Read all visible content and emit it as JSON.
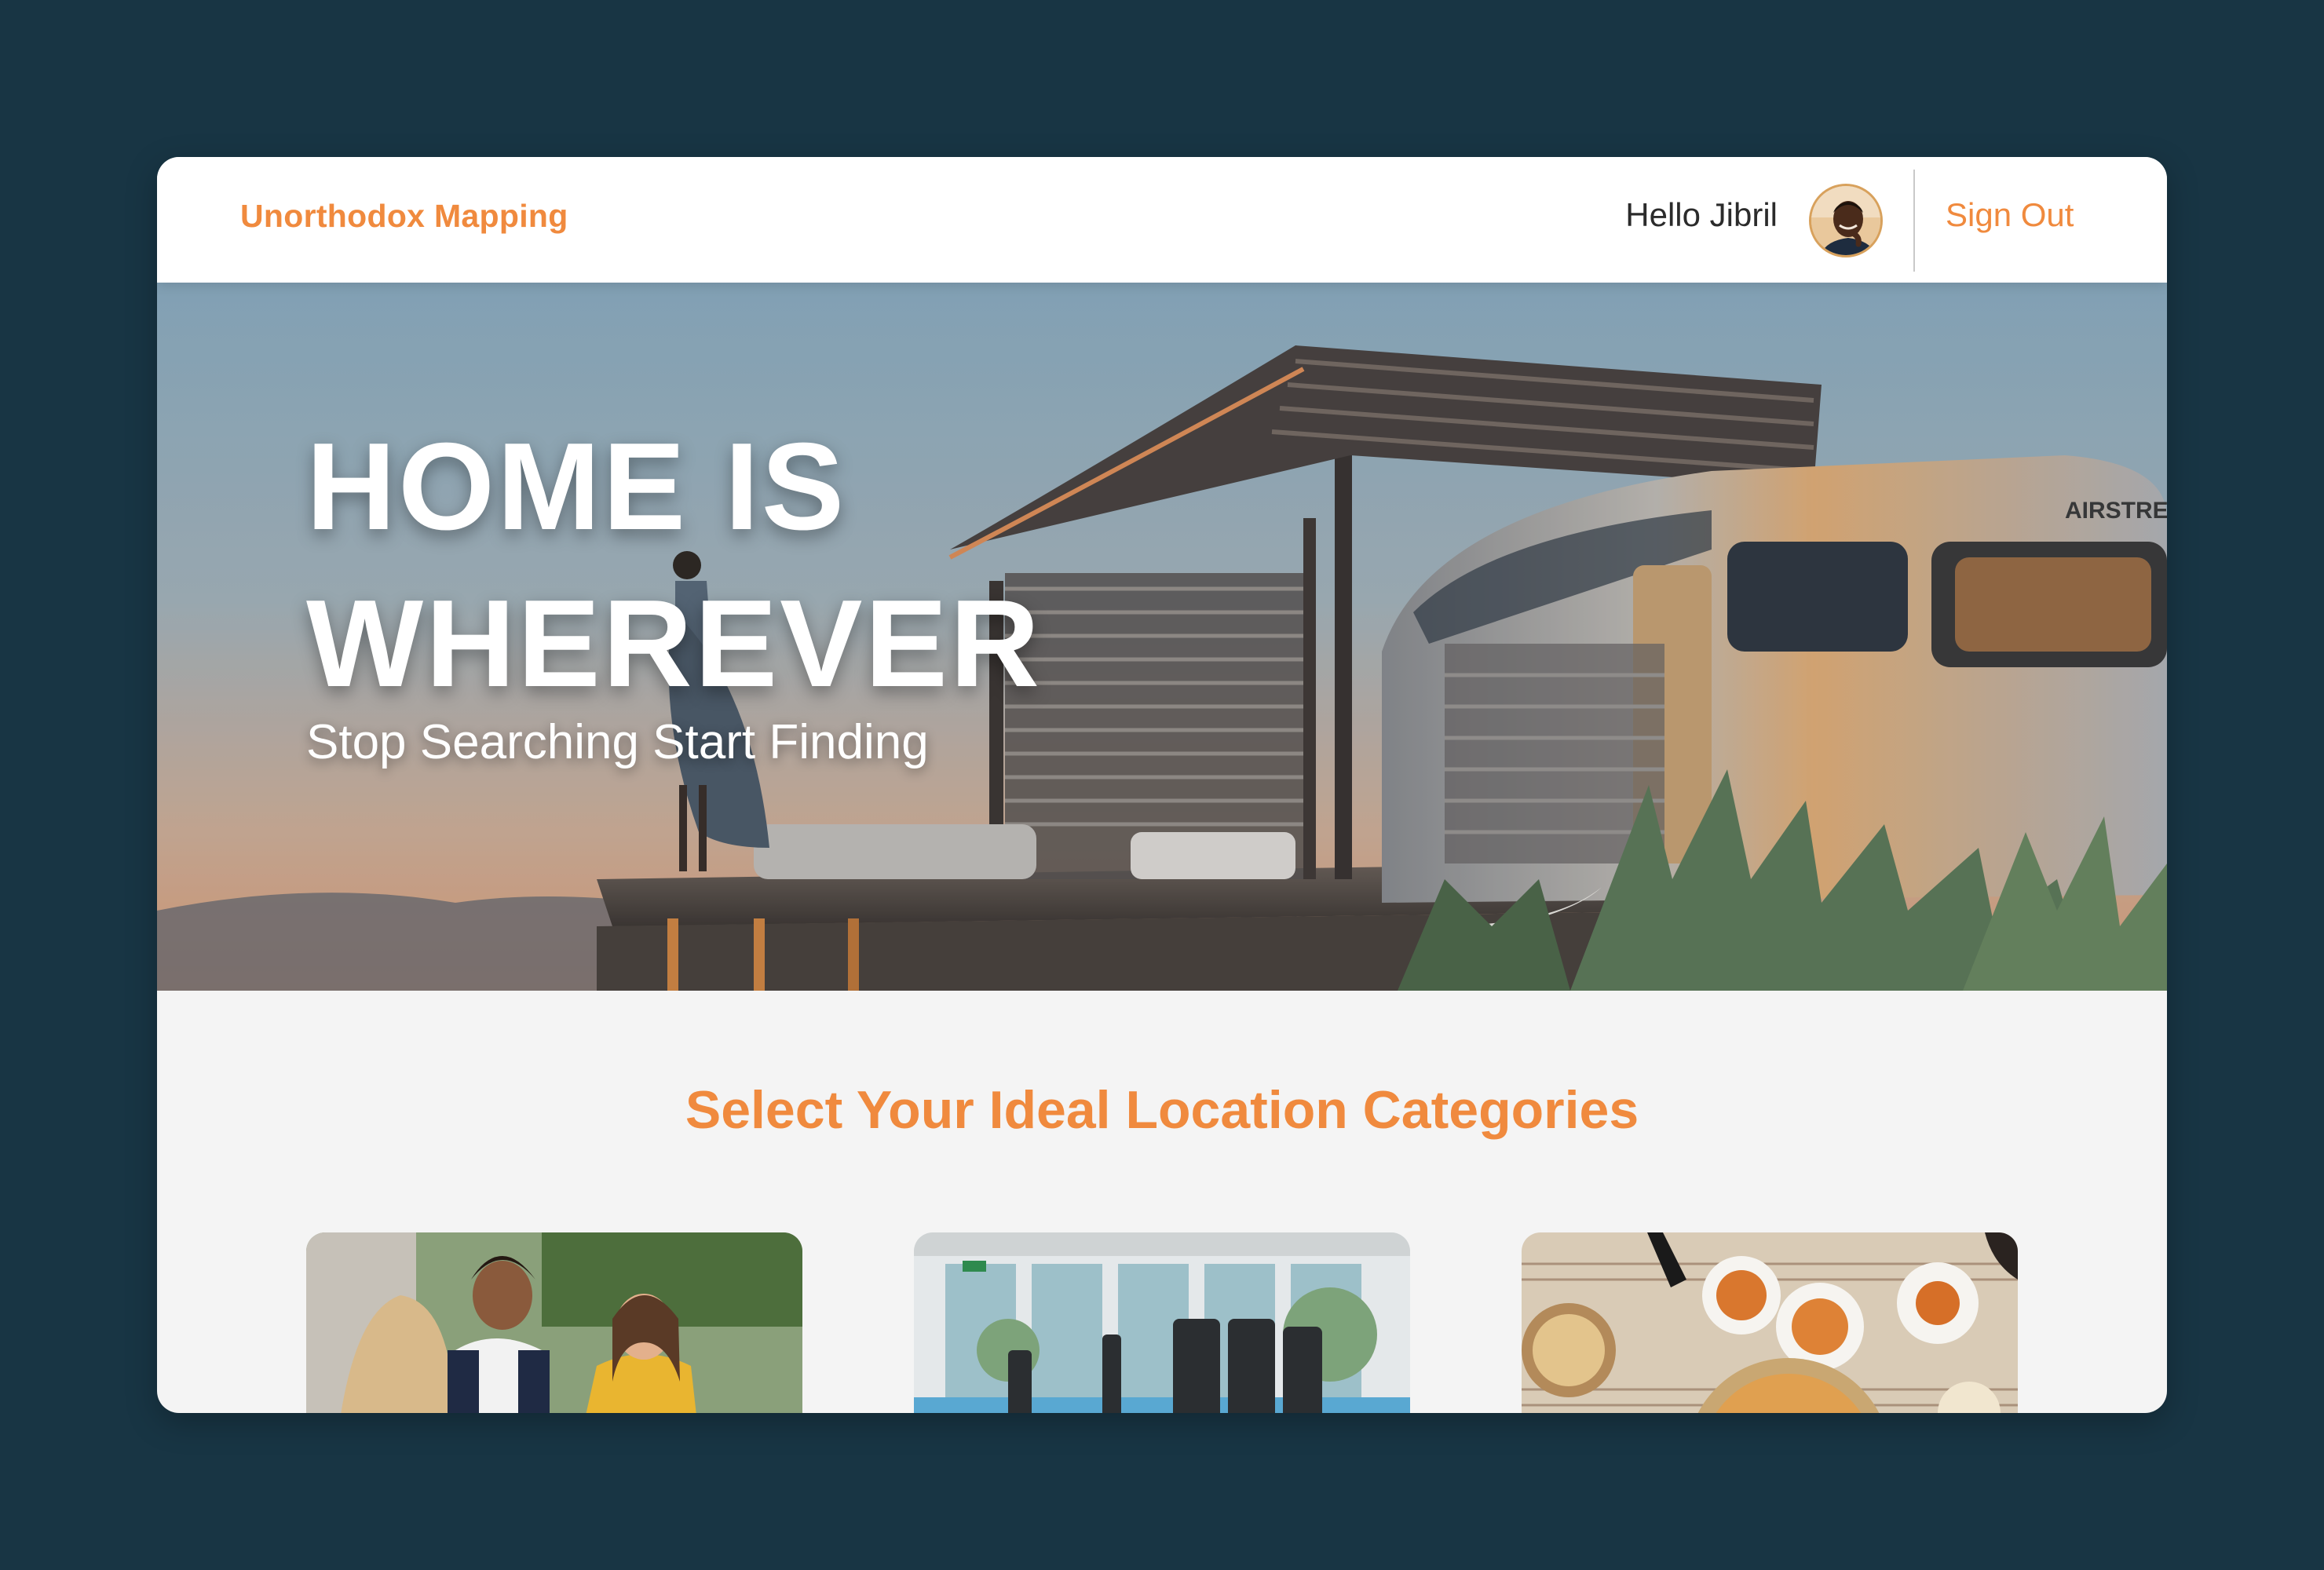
{
  "header": {
    "brand": "Unorthodox Mapping",
    "greeting": "Hello Jibril",
    "avatar_icon": "user-avatar-icon",
    "sign_out": "Sign Out"
  },
  "hero": {
    "title_line1": "HOME IS",
    "title_line2": "WHEREVER",
    "subtitle": "Stop Searching Start Finding",
    "trailer_text": "AIRSTREA"
  },
  "categories": {
    "title": "Select Your Ideal Location Categories",
    "cards": [
      {
        "image": "social-people-photo"
      },
      {
        "image": "gym-fitness-photo"
      },
      {
        "image": "food-dining-photo"
      }
    ]
  },
  "colors": {
    "accent": "#f08a3e",
    "background": "#183544",
    "panel": "#f4f4f4"
  }
}
